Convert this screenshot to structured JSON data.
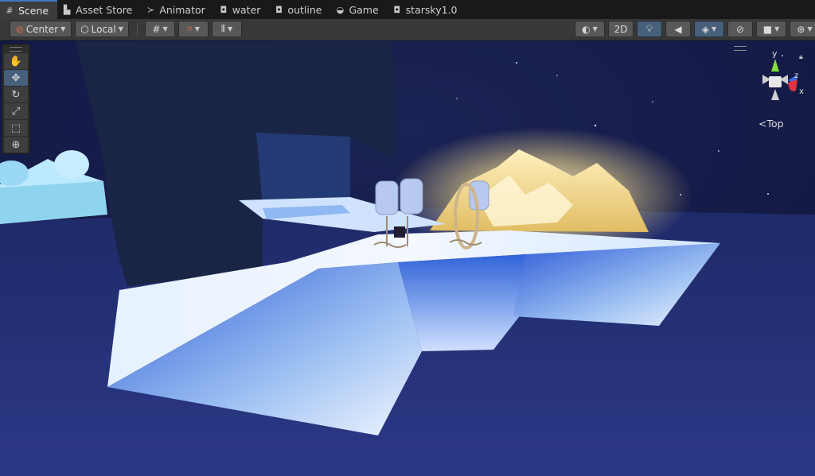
{
  "tabs": [
    {
      "label": "Scene",
      "icon": "grid-icon",
      "glyph": "#"
    },
    {
      "label": "Asset Store",
      "icon": "bag-icon",
      "glyph": "▙"
    },
    {
      "label": "Animator",
      "icon": "animator-icon",
      "glyph": "≻"
    },
    {
      "label": "water",
      "icon": "material-icon",
      "glyph": "◘"
    },
    {
      "label": "outline",
      "icon": "material-icon",
      "glyph": "◘"
    },
    {
      "label": "Game",
      "icon": "gamepad-icon",
      "glyph": "◒"
    },
    {
      "label": "starsky1.0",
      "icon": "material-icon",
      "glyph": "◘"
    }
  ],
  "toolbar": {
    "pivot_mode": "Center",
    "pivot_rotation": "Local",
    "mode_2d": "2D"
  },
  "tools": [
    {
      "name": "hand-tool",
      "glyph": "✋"
    },
    {
      "name": "move-tool",
      "glyph": "✥"
    },
    {
      "name": "rotate-tool",
      "glyph": "↻"
    },
    {
      "name": "scale-tool",
      "glyph": "⤢"
    },
    {
      "name": "rect-tool",
      "glyph": "⬚"
    },
    {
      "name": "transform-tool",
      "glyph": "⊕"
    }
  ],
  "gizmo": {
    "y": "y",
    "z": "z",
    "x": "x",
    "view": "Top",
    "back_glyph": "<"
  },
  "colors": {
    "accent": "#46607c",
    "tab_active_border": "#3a79bb",
    "axis_y": "#7fe03a",
    "axis_x": "#e0343d",
    "axis_z": "#3a6ee0"
  }
}
